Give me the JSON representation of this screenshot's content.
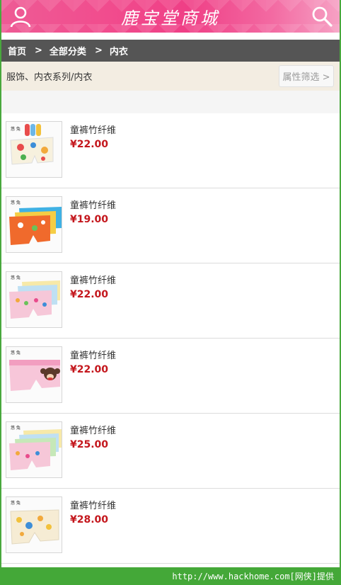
{
  "header": {
    "title": "鹿宝堂商城",
    "user_icon": "user-icon",
    "search_icon": "search-icon",
    "color": "#ef3f86"
  },
  "breadcrumb": {
    "home": "首页",
    "separator": ">",
    "all_categories": "全部分类",
    "current": "内衣"
  },
  "filterbar": {
    "category_path": "服饰、内衣系列/内衣",
    "filter_button": "属性筛选 >"
  },
  "products": [
    {
      "name": "童裤竹纤维",
      "price": "¥22.00",
      "image": "product-image-1"
    },
    {
      "name": "童裤竹纤维",
      "price": "¥19.00",
      "image": "product-image-2"
    },
    {
      "name": "童裤竹纤维",
      "price": "¥22.00",
      "image": "product-image-3"
    },
    {
      "name": "童裤竹纤维",
      "price": "¥22.00",
      "image": "product-image-4"
    },
    {
      "name": "童裤竹纤维",
      "price": "¥25.00",
      "image": "product-image-5"
    },
    {
      "name": "童裤竹纤维",
      "price": "¥28.00",
      "image": "product-image-6"
    }
  ],
  "footer": {
    "watermark": "http://www.hackhome.com[网侠]提供"
  },
  "colors": {
    "price": "#c4171d",
    "breadcrumb_bg": "#555555",
    "filterbar_bg": "#f3ede2",
    "footer_bg": "#44a838"
  }
}
